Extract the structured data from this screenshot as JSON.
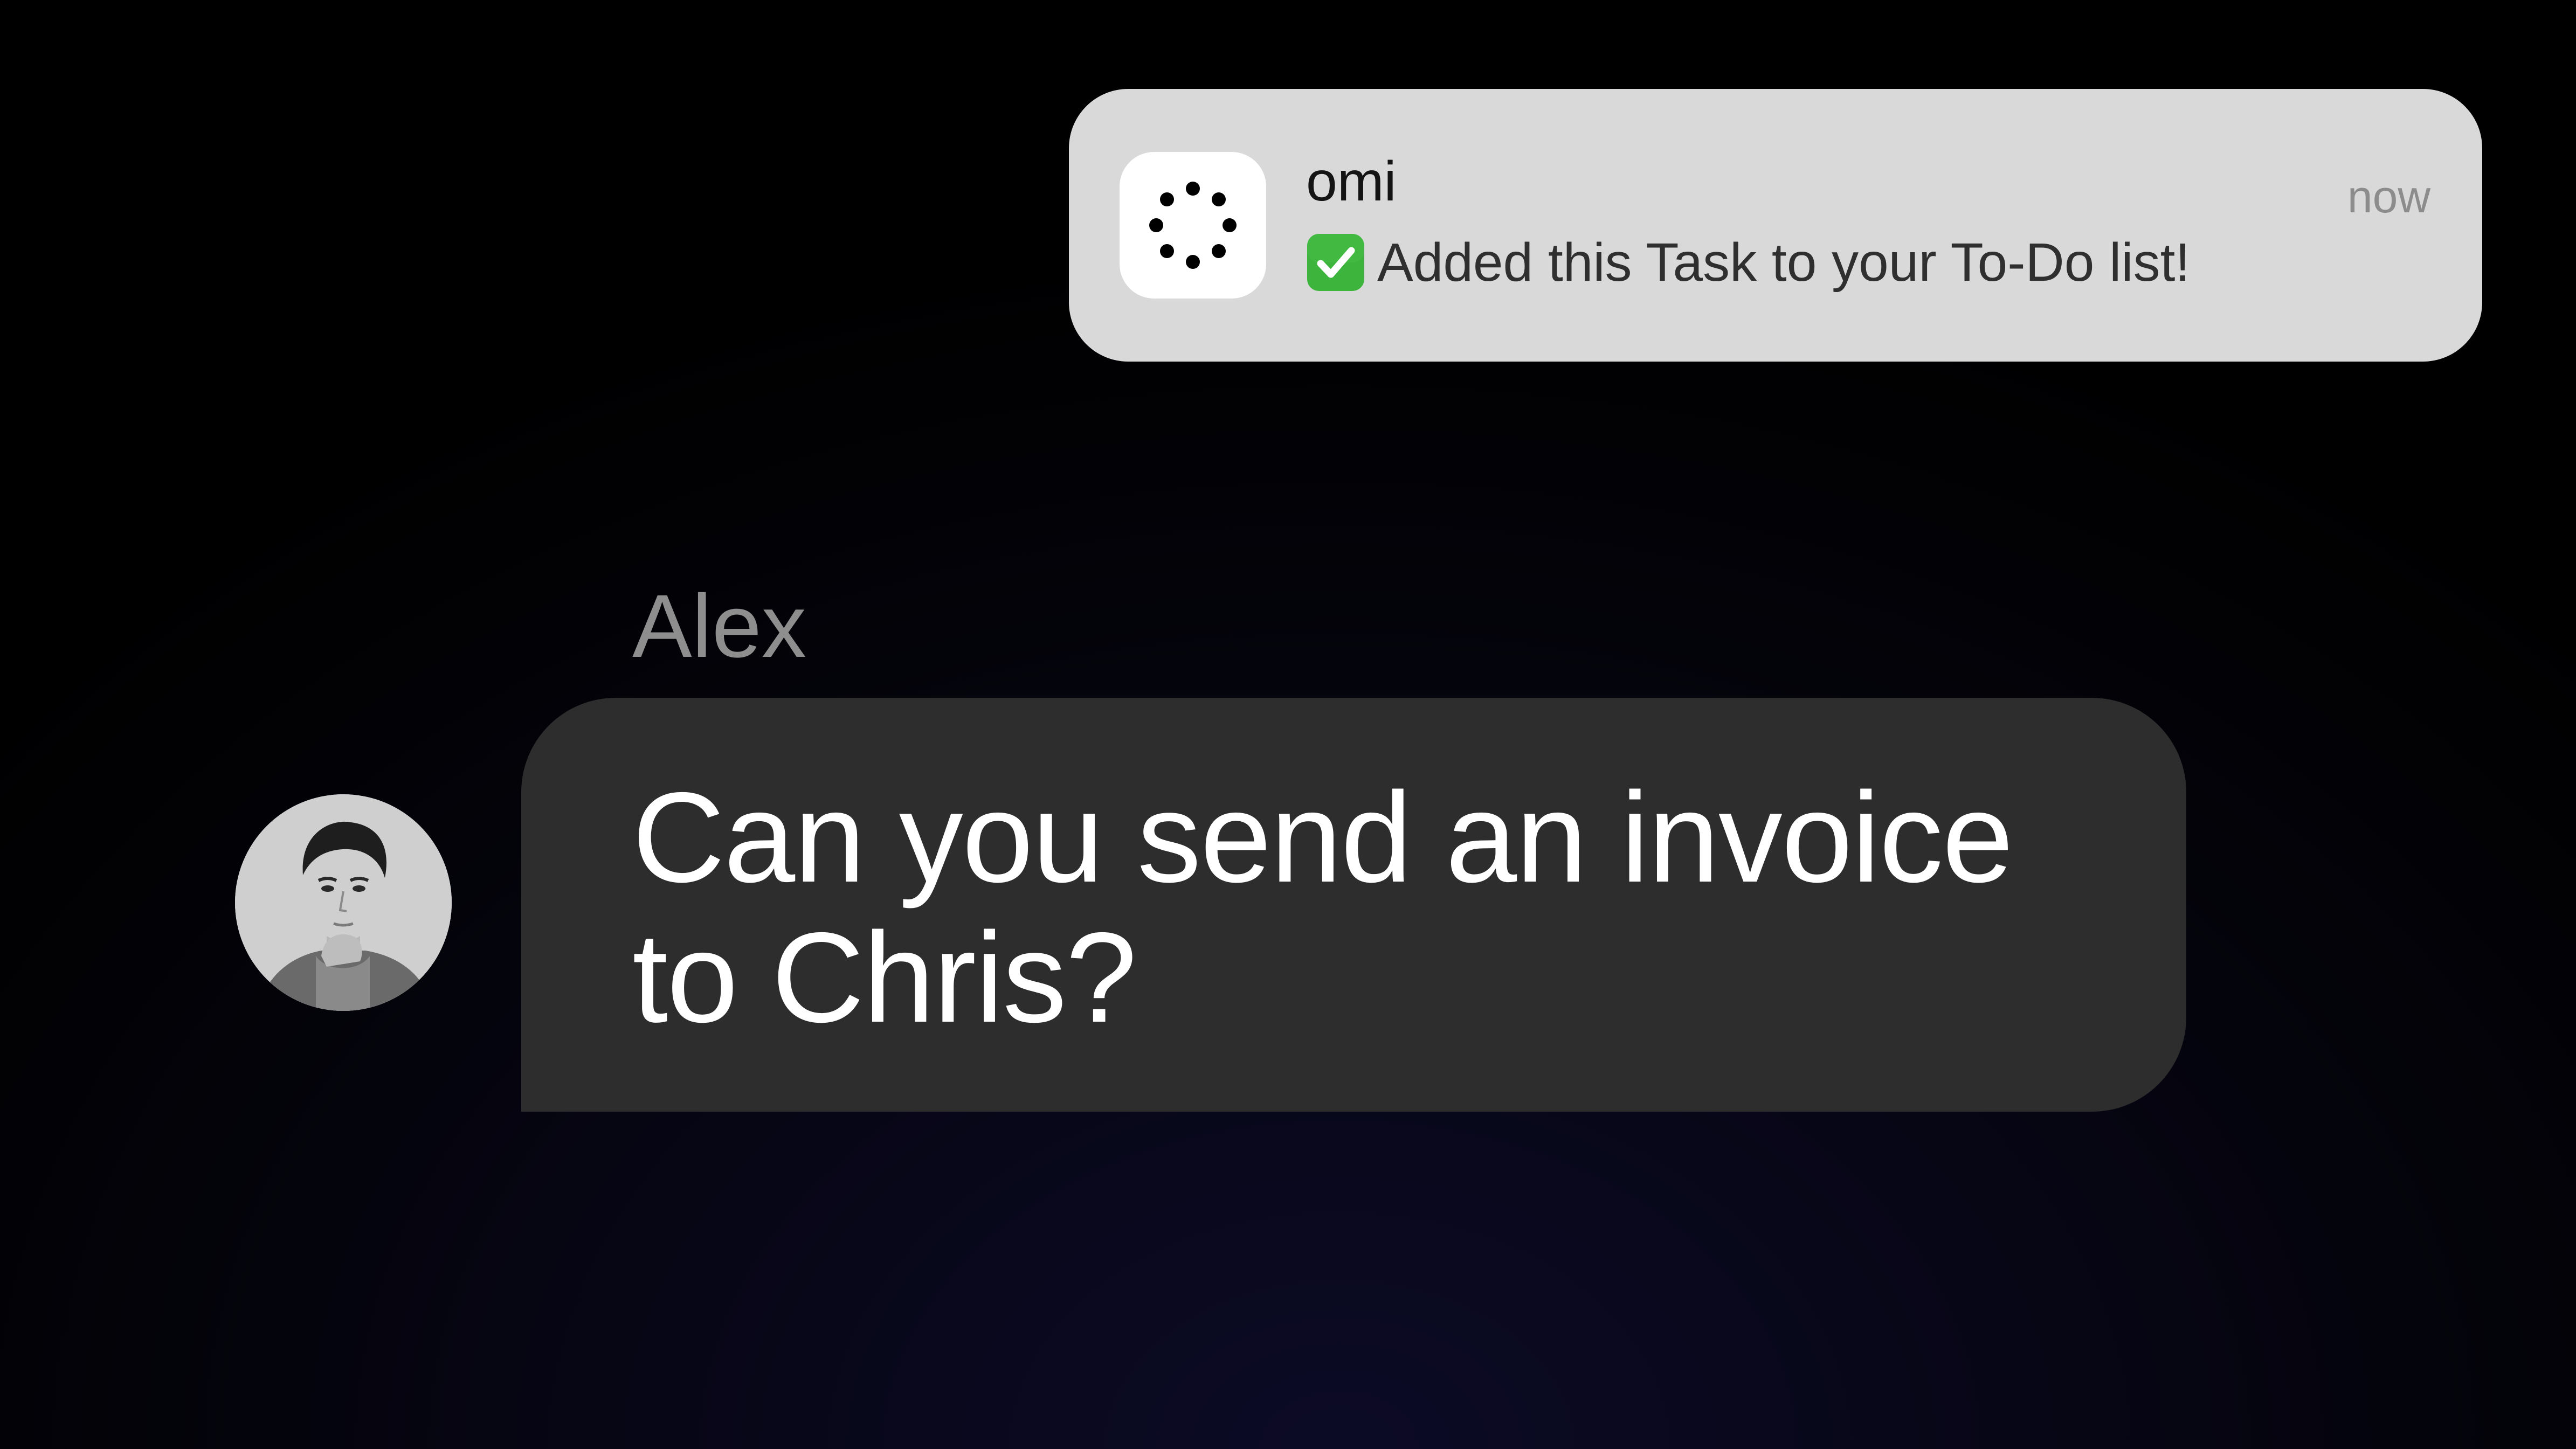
{
  "notification": {
    "app_name": "omi",
    "time": "now",
    "message": "Added this Task to your To-Do list!",
    "message_icon": "check-mark-button-emoji",
    "app_icon": "omi-dotted-circle-logo"
  },
  "chat": {
    "sender_name": "Alex",
    "message": "Can you send an invoice to Chris?",
    "avatar": "user-avatar-photo"
  },
  "colors": {
    "notification_bg": "#d9d9d9",
    "bubble_bg": "#2d2d2d",
    "check_green": "#3db53d",
    "background": "#000000"
  }
}
